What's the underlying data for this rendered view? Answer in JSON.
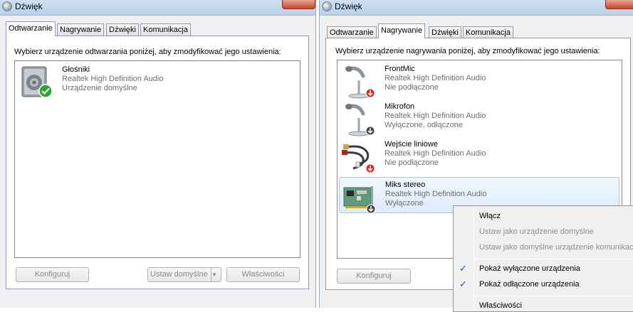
{
  "left_window": {
    "title": "Dźwięk",
    "tabs": [
      {
        "label": "Odtwarzanie"
      },
      {
        "label": "Nagrywanie"
      },
      {
        "label": "Dźwięki"
      },
      {
        "label": "Komunikacja"
      }
    ],
    "active_tab": "Odtwarzanie",
    "instruction": "Wybierz urządzenie odtwarzania poniżej, aby zmodyfikować jego ustawienia:",
    "devices": [
      {
        "name": "Głośniki",
        "driver": "Realtek High Definition Audio",
        "status": "Urządzenie domyślne",
        "icon": "speaker-icon",
        "badge": "default-check-icon"
      }
    ],
    "buttons": {
      "configure": "Konfiguruj",
      "set_default": "Ustaw domyślne",
      "properties": "Właściwości"
    }
  },
  "right_window": {
    "title": "Dźwięk",
    "tabs": [
      {
        "label": "Odtwarzanie"
      },
      {
        "label": "Nagrywanie"
      },
      {
        "label": "Dźwięki"
      },
      {
        "label": "Komunikacja"
      }
    ],
    "active_tab": "Nagrywanie",
    "instruction": "Wybierz urządzenie nagrywania poniżej, aby zmodyfikować jego ustawienia:",
    "devices": [
      {
        "name": "FrontMic",
        "driver": "Realtek High Definition Audio",
        "status": "Nie podłączone",
        "icon": "microphone-icon",
        "badge": "unplugged-icon"
      },
      {
        "name": "Mikrofon",
        "driver": "Realtek High Definition Audio",
        "status": "Wyłączone, odłączone",
        "icon": "microphone-icon",
        "badge": "disabled-icon"
      },
      {
        "name": "Wejście liniowe",
        "driver": "Realtek High Definition Audio",
        "status": "Nie podłączone",
        "icon": "line-in-cable-icon",
        "badge": "unplugged-icon"
      },
      {
        "name": "Miks stereo",
        "driver": "Realtek High Definition Audio",
        "status": "Wyłączone",
        "icon": "sound-card-icon",
        "badge": "disabled-icon"
      }
    ],
    "buttons": {
      "configure": "Konfiguruj"
    }
  },
  "context_menu": {
    "items": [
      {
        "label": "Włącz",
        "enabled": true,
        "checked": false
      },
      {
        "label": "Ustaw jako urządzenie domyślne",
        "enabled": false,
        "checked": false
      },
      {
        "label": "Ustaw jako domyślne urządzenie komunikacyjne",
        "enabled": false,
        "checked": false
      },
      {
        "label": "Pokaż wyłączone urządzenia",
        "enabled": true,
        "checked": true
      },
      {
        "label": "Pokaż odłączone urządzenia",
        "enabled": true,
        "checked": true
      },
      {
        "label": "Właściwości",
        "enabled": true,
        "checked": false
      }
    ],
    "check_glyph": "✓"
  },
  "colors": {
    "selection": "#dcebfc",
    "check_green": "#2ea62e",
    "badge_red": "#d9261c",
    "badge_dark": "#444444"
  }
}
